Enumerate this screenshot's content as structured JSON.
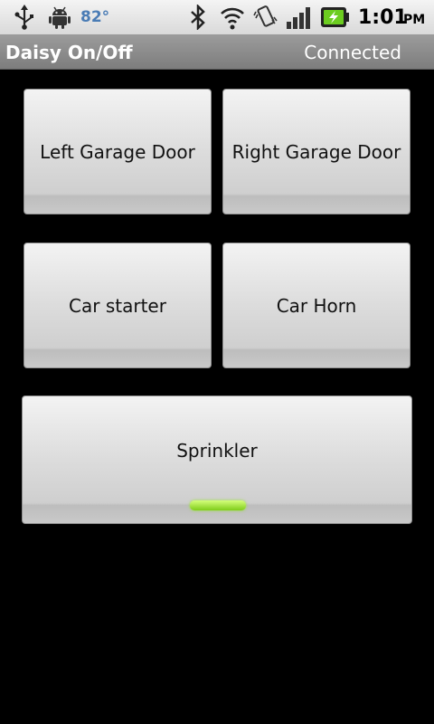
{
  "status_bar": {
    "temperature": "82°",
    "time": "1:01",
    "ampm": "PM",
    "icons": [
      "usb-icon",
      "android-icon",
      "bluetooth-icon",
      "wifi-icon",
      "vibrate-icon",
      "signal-icon",
      "battery-charging-icon"
    ],
    "temp_color": "#4a7cb5"
  },
  "title_bar": {
    "title": "Daisy On/Off",
    "status": "Connected"
  },
  "buttons": {
    "left_garage": "Left Garage Door",
    "right_garage": "Right Garage Door",
    "car_starter": "Car starter",
    "car_horn": "Car Horn",
    "sprinkler": "Sprinkler"
  },
  "sprinkler_toggle": {
    "on": true,
    "indicator_color": "#8be02a"
  }
}
